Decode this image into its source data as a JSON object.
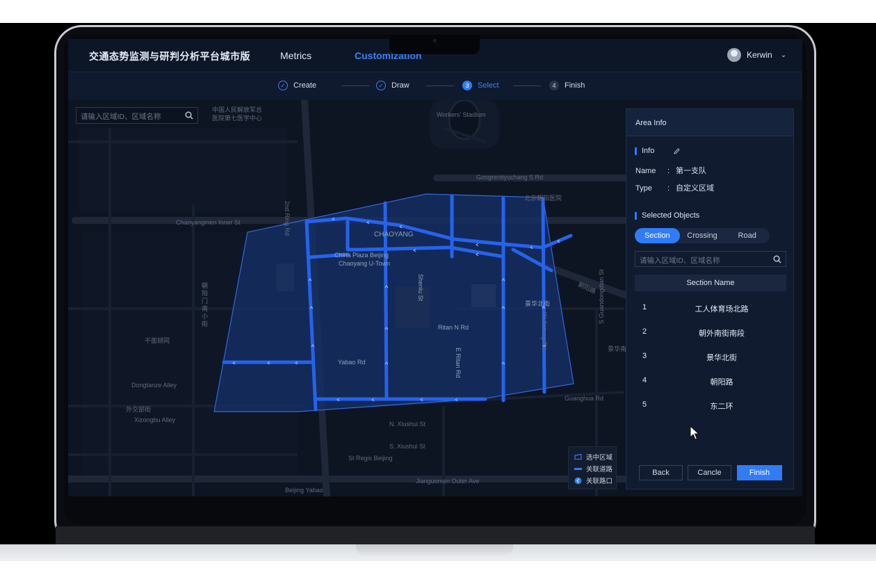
{
  "app": {
    "title": "交通态势监测与研判分析平台城市版",
    "tabs": [
      {
        "label": "Metrics",
        "active": false
      },
      {
        "label": "Customization",
        "active": true
      }
    ],
    "user": {
      "name": "Kerwin"
    }
  },
  "steps": [
    {
      "num": "1",
      "label": "Create",
      "state": "done"
    },
    {
      "num": "2",
      "label": "Draw",
      "state": "done"
    },
    {
      "num": "3",
      "label": "Select",
      "state": "current"
    },
    {
      "num": "4",
      "label": "Finish",
      "state": "todo"
    }
  ],
  "map": {
    "search_placeholder": "请输入区域ID、区域名称",
    "labels": [
      "中国人民解放军总",
      "医院第七医学中心",
      "Workers' Stadium",
      "Gongrentiyuchang S Rd",
      "北京朝阳医院",
      "Chaoyangmen Inner St",
      "2nd Ring Rd",
      "CHAOYANG",
      "China Plaza Beijing",
      "Chaoyang U-Town",
      "朝阳门南小街",
      "干面胡同",
      "Dongtanze Alley",
      "外交部街",
      "Xizongbu Alley",
      "Yabao Rd",
      "Shenlu St",
      "Ritan N Rd",
      "E Ritan Rd",
      "景华北街",
      "W Jintong Rd",
      "朝阳路",
      "S Guandongdian St",
      "景华南街",
      "Guanghua Rd",
      "N. Xiushui St",
      "S. Xiushui St",
      "St Regis Beijing",
      "Jianguomen Outer Ave",
      "Beijing Yabao"
    ],
    "legend": [
      {
        "label": "选中区域",
        "icon": "area-icon"
      },
      {
        "label": "关联道路",
        "icon": "road-icon"
      },
      {
        "label": "关联路口",
        "icon": "crossing-icon"
      }
    ],
    "colors": {
      "accent": "#2f7cf6",
      "road": "#2563eb",
      "area_fill": "#16306a"
    }
  },
  "panel": {
    "title": "Area Info",
    "info_title": "Info",
    "name_key": "Name",
    "name_value": "第一支队",
    "type_key": "Type",
    "type_value": "自定义区域",
    "selected_title": "Selected Objects",
    "segments": [
      "Section",
      "Crossing",
      "Road"
    ],
    "search_placeholder": "请输入区域ID、区域名称",
    "table_header": "Section Name",
    "rows": [
      {
        "num": "1",
        "name": "工人体育场北路"
      },
      {
        "num": "2",
        "name": "朝外南街南段"
      },
      {
        "num": "3",
        "name": "景华北街"
      },
      {
        "num": "4",
        "name": "朝阳路"
      },
      {
        "num": "5",
        "name": "东二环"
      }
    ],
    "buttons": {
      "back": "Back",
      "cancel": "Cancle",
      "finish": "Finish"
    }
  }
}
